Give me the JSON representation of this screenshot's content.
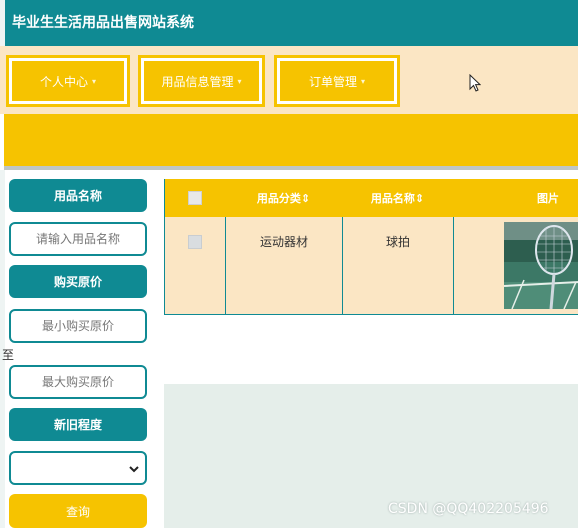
{
  "header": {
    "title": "毕业生生活用品出售网站系统"
  },
  "nav": {
    "items": [
      {
        "label": "个人中心",
        "caret": "▾"
      },
      {
        "label": "用品信息管理",
        "caret": "▾"
      },
      {
        "label": "订单管理",
        "caret": "▾"
      }
    ]
  },
  "search": {
    "name_label": "用品名称",
    "name_placeholder": "请输入用品名称",
    "price_label": "购买原价",
    "min_price_placeholder": "最小购买原价",
    "range_separator": "至",
    "max_price_placeholder": "最大购买原价",
    "condition_label": "新旧程度",
    "condition_selected": "",
    "query_button": "查询"
  },
  "table": {
    "columns": [
      "",
      "用品分类⇕",
      "用品名称⇕",
      "图片"
    ],
    "rows": [
      {
        "category": "运动器材",
        "name": "球拍",
        "image": "racket-photo"
      }
    ]
  },
  "watermark": "CSDN @QQ402205496",
  "colors": {
    "teal": "#0f8a93",
    "gold": "#f6c300",
    "cream": "#fbe6c4"
  }
}
